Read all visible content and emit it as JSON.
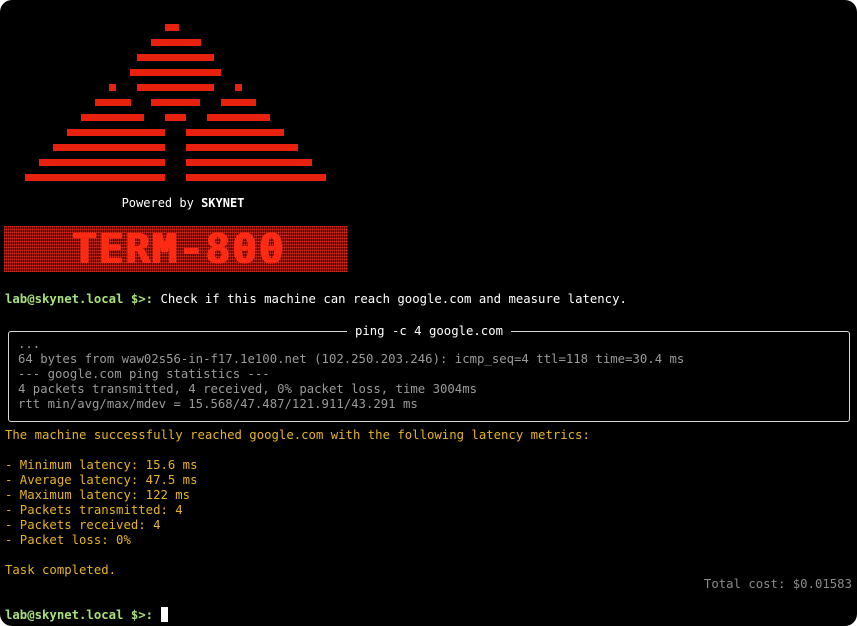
{
  "logo": {
    "powered_prefix": "Powered by",
    "powered_brand": "SKYNET",
    "banner_text": "TERM-800",
    "colors": {
      "accent": "#e8210f",
      "banner": "#ff2a14"
    }
  },
  "session": {
    "prompt": "lab@skynet.local $>:",
    "command": "Check if this machine can reach google.com and measure latency."
  },
  "tool_box": {
    "title": "ping -c 4 google.com",
    "lines": [
      "...",
      "64 bytes from waw02s56-in-f17.1e100.net (102.250.203.246): icmp_seq=4 ttl=118 time=30.4 ms",
      "--- google.com ping statistics ---",
      "4 packets transmitted, 4 received, 0% packet loss, time 3004ms",
      "rtt min/avg/max/mdev = 15.568/47.487/121.911/43.291 ms"
    ]
  },
  "response": {
    "intro": "The machine successfully reached google.com with the following latency metrics:",
    "items": [
      "- Minimum latency: 15.6 ms",
      "- Average latency: 47.5 ms",
      "- Maximum latency: 122 ms",
      "- Packets transmitted: 4",
      "- Packets received: 4",
      "- Packet loss: 0%"
    ],
    "done": "Task completed.",
    "cost": "Total cost: $0.01583"
  },
  "input": {
    "prompt": "lab@skynet.local $>:",
    "value": ""
  }
}
